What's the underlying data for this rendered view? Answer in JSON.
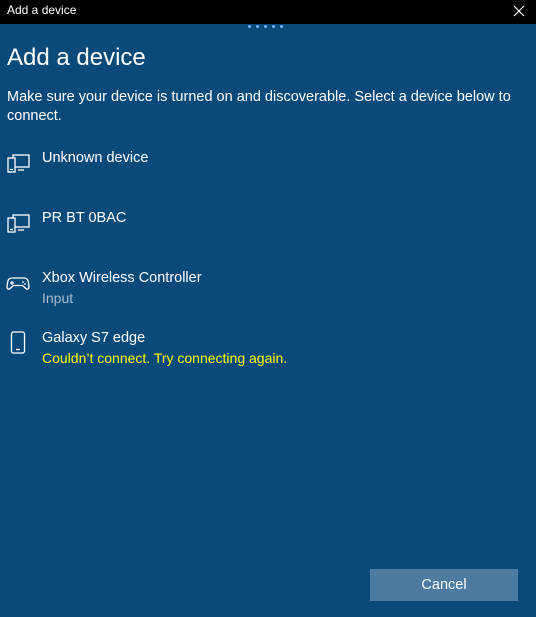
{
  "window": {
    "title": "Add a device",
    "close_icon": "close-icon"
  },
  "colors": {
    "background": "#0a4a7a",
    "titlebar": "#000000",
    "accent_progress": "#7fb3ff",
    "muted_text": "#a7bdd3",
    "error_text": "#ffff00",
    "button_bg": "#4c7aa1"
  },
  "page": {
    "title": "Add a device",
    "instructions": "Make sure your device is turned on and discoverable. Select a device below to connect."
  },
  "devices": [
    {
      "name": "Unknown device",
      "icon": "display-device-icon",
      "status": ""
    },
    {
      "name": "PR BT 0BAC",
      "icon": "display-device-icon",
      "status": ""
    },
    {
      "name": "Xbox Wireless Controller",
      "icon": "gamepad-icon",
      "status": "Input"
    },
    {
      "name": "Galaxy S7 edge",
      "icon": "phone-icon",
      "status": "Couldn’t connect. Try connecting again."
    }
  ],
  "footer": {
    "cancel_label": "Cancel"
  }
}
